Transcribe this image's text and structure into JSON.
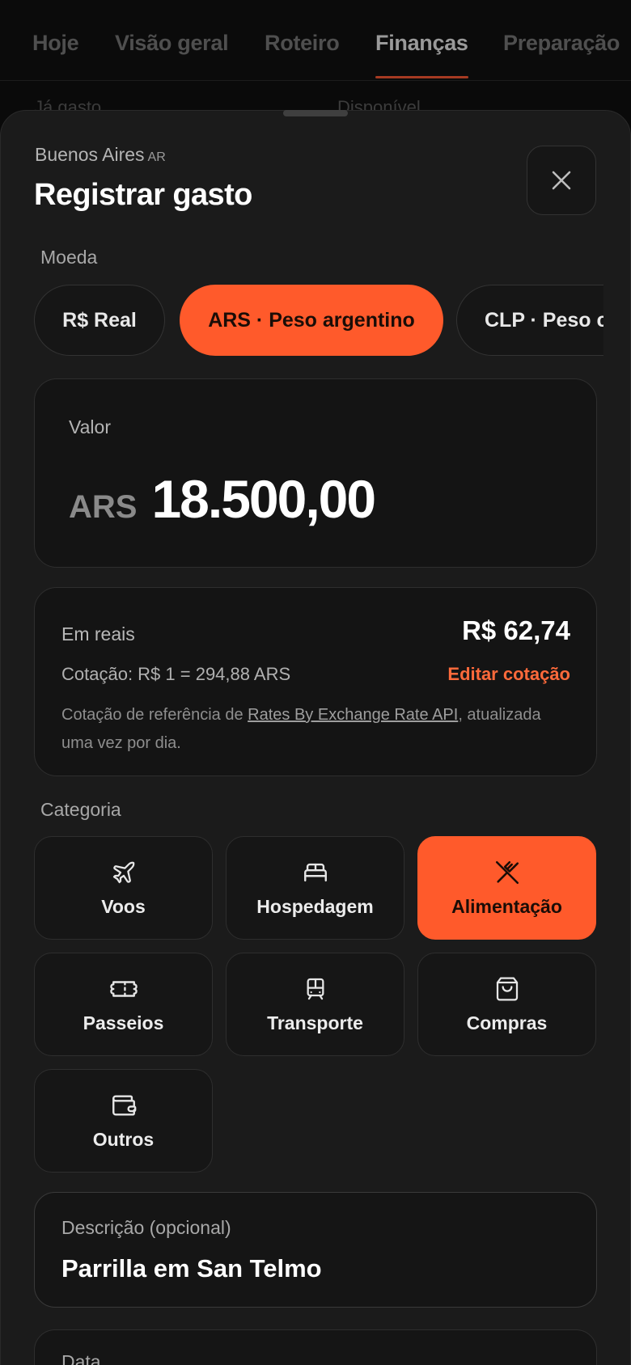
{
  "tabs": [
    {
      "label": "Hoje",
      "active": false
    },
    {
      "label": "Visão geral",
      "active": false
    },
    {
      "label": "Roteiro",
      "active": false
    },
    {
      "label": "Finanças",
      "active": true
    },
    {
      "label": "Preparação",
      "active": false
    }
  ],
  "behind": {
    "spent_label": "Já gasto",
    "available_label": "Disponível"
  },
  "sheet": {
    "city": "Buenos Aires",
    "country_code": "AR",
    "title": "Registrar gasto",
    "close_icon": "close-icon"
  },
  "currency": {
    "label": "Moeda",
    "options": [
      {
        "label": "R$ Real",
        "selected": false
      },
      {
        "label": "ARS · Peso argentino",
        "selected": true
      },
      {
        "label": "CLP · Peso chileno",
        "selected": false
      }
    ]
  },
  "amount": {
    "label": "Valor",
    "currency_code": "ARS",
    "value": "18.500,00"
  },
  "conversion": {
    "label": "Em reais",
    "value": "R$ 62,74",
    "rate_text": "Cotação: R$ 1 = 294,88 ARS",
    "edit_label": "Editar cotação",
    "note_prefix": "Cotação de referência de ",
    "note_link": "Rates By Exchange Rate API",
    "note_suffix": ", atualizada uma vez por dia."
  },
  "category": {
    "label": "Categoria",
    "items": [
      {
        "label": "Voos",
        "icon": "plane-icon",
        "selected": false
      },
      {
        "label": "Hospedagem",
        "icon": "bed-icon",
        "selected": false
      },
      {
        "label": "Alimentação",
        "icon": "utensils-icon",
        "selected": true
      },
      {
        "label": "Passeios",
        "icon": "ticket-icon",
        "selected": false
      },
      {
        "label": "Transporte",
        "icon": "train-icon",
        "selected": false
      },
      {
        "label": "Compras",
        "icon": "shopping-bag-icon",
        "selected": false
      },
      {
        "label": "Outros",
        "icon": "wallet-icon",
        "selected": false
      }
    ]
  },
  "description": {
    "label": "Descrição (opcional)",
    "value": "Parrilla em San Telmo"
  },
  "date": {
    "label": "Data"
  },
  "colors": {
    "accent": "#ff5a2b",
    "background": "#1b1b1b",
    "card": "#141414"
  }
}
